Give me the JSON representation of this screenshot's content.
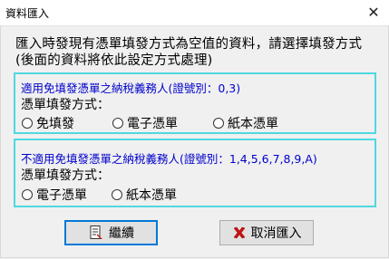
{
  "window": {
    "title": "資料匯入",
    "close_glyph": "✕"
  },
  "intro_text": "匯入時發現有憑單填發方式為空值的資料，請選擇填發方式(後面的資料將依此設定方式處理)",
  "group1": {
    "title": "適用免填發憑單之納稅義務人(證號別：0,3)",
    "label": "憑單填發方式：",
    "options": [
      "免填發",
      "電子憑單",
      "紙本憑單"
    ]
  },
  "group2": {
    "title": "不適用免填發憑單之納稅義務人(證號別：1,4,5,6,7,8,9,A)",
    "label": "憑單填發方式：",
    "options": [
      "電子憑單",
      "紙本憑單"
    ]
  },
  "buttons": {
    "continue_label": "繼續",
    "cancel_label": "取消匯入"
  },
  "colors": {
    "group_border": "#4fd8e0",
    "group_title": "#0000cc",
    "cancel_icon": "#cc1111"
  },
  "icons": {
    "continue": "document-icon",
    "cancel": "red-x-icon"
  }
}
